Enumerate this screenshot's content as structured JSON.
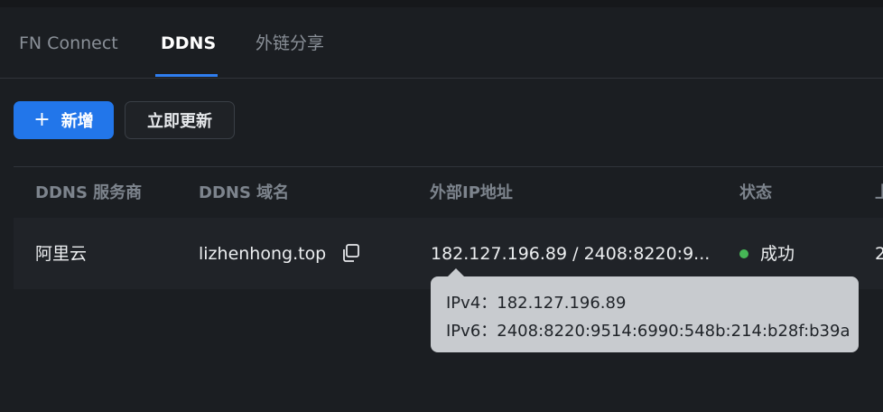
{
  "tabs": [
    {
      "label": "FN Connect",
      "active": false
    },
    {
      "label": "DDNS",
      "active": true
    },
    {
      "label": "外链分享",
      "active": false
    }
  ],
  "toolbar": {
    "add_icon": "plus-icon",
    "add_label": "新增",
    "refresh_label": "立即更新"
  },
  "table": {
    "headers": [
      "DDNS 服务商",
      "DDNS 域名",
      "外部IP地址",
      "状态",
      "上"
    ],
    "rows": [
      {
        "provider": "阿里云",
        "domain": "lizhenhong.top",
        "copy_icon": "copy-icon",
        "ip": "182.127.196.89 / 2408:8220:9...",
        "status": "成功",
        "status_color": "#46b756",
        "last": "2"
      }
    ]
  },
  "tooltip": {
    "ipv4_label": "IPv4：",
    "ipv4": "182.127.196.89",
    "ipv6_label": "IPv6：",
    "ipv6": "2408:8220:9514:6990:548b:214:b28f:b39a"
  },
  "colors": {
    "accent": "#2276ea",
    "background": "#1b1e22",
    "success": "#46b756"
  }
}
